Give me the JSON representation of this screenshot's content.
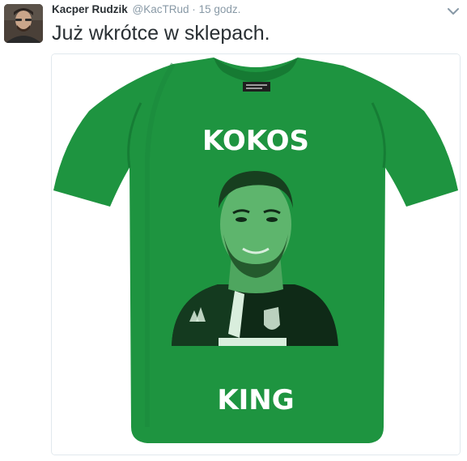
{
  "tweet": {
    "author_name": "Kacper Rudzik",
    "handle": "@KacTRud",
    "separator": "·",
    "timestamp": "15 godz.",
    "text": "Już wkrótce w sklepach."
  },
  "media": {
    "shirt_top_text": "KOKOS",
    "shirt_bottom_text": "KING",
    "shirt_color": "#1e9440",
    "icon": "t-shirt-photo"
  },
  "icons": {
    "caret": "chevron-down-icon",
    "avatar": "avatar"
  }
}
